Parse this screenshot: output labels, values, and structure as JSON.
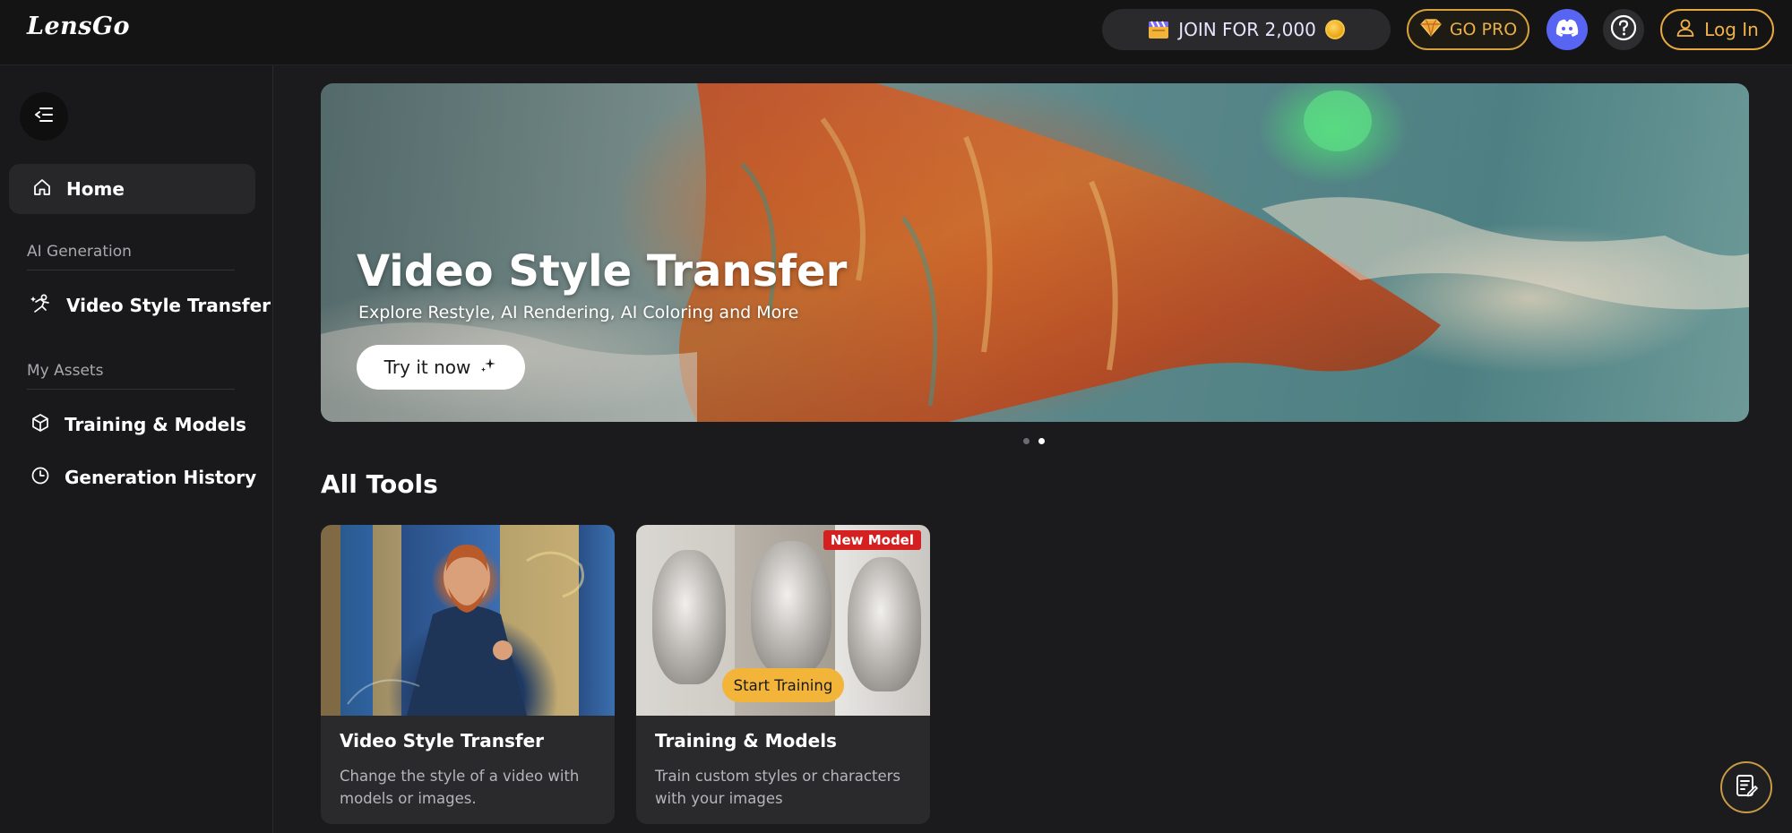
{
  "header": {
    "logo_text": "LensGo",
    "join_label": "JOIN FOR 2,000",
    "gopro_label": "GO PRO",
    "login_label": "Log In",
    "icons": [
      "clapperboard-icon",
      "coin-icon",
      "diamond-icon",
      "discord-icon",
      "help-icon",
      "user-icon"
    ]
  },
  "sidebar": {
    "home_label": "Home",
    "sections": [
      {
        "label": "AI Generation",
        "items": [
          {
            "label": "Video Style Transfer",
            "icon": "style-transfer-icon"
          }
        ]
      },
      {
        "label": "My Assets",
        "items": [
          {
            "label": "Training & Models",
            "icon": "cube-icon"
          },
          {
            "label": "Generation History",
            "icon": "clock-icon"
          }
        ]
      }
    ]
  },
  "banner": {
    "title": "Video Style Transfer",
    "subtitle": "Explore Restyle, AI Rendering, AI Coloring and More",
    "cta_label": "Try it now",
    "slide_count": 2,
    "active_slide": 2
  },
  "tools": {
    "heading": "All Tools",
    "cards": [
      {
        "title": "Video Style Transfer",
        "description": "Change the style of a video with models or images."
      },
      {
        "title": "Training & Models",
        "description": "Train custom styles or characters with your images",
        "badge": "New Model",
        "overlay_button": "Start Training"
      }
    ]
  },
  "colors": {
    "accent_gold": "#e8a83e",
    "discord_blue": "#5865f2",
    "badge_red": "#d42020",
    "background": "#1b1b1d"
  }
}
